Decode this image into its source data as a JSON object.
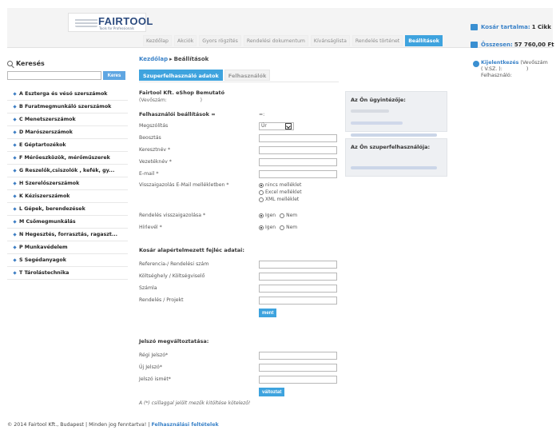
{
  "header": {
    "logo_text": "FAIRTOOL",
    "logo_sub": "Tools for Professionals",
    "nav": [
      "Kezdőlap",
      "Akciók",
      "Gyors rögzítés",
      "Rendelési dokumentum",
      "Kívánságlista",
      "Rendelés történet",
      "Beállítások"
    ],
    "cart_label": "Kosár tartalma:",
    "cart_value": "1 Cikk",
    "total_label": "Összesen:",
    "total_value": "57 760,00 Ft"
  },
  "search": {
    "title": "Keresés",
    "button": "Keres",
    "placeholder": ""
  },
  "sidebar": {
    "items": [
      "A Esztergа és vésó szerszámok",
      "B Furatmegmunkáló szerszámok",
      "C Menetszerszámok",
      "D Marószerszámok",
      "E Géptartozékok",
      "F Mérőeszközök, mérőműszerek",
      "G Reszelők,csiszolók , kefék, gy...",
      "H Szerelőszerszámok",
      "K Kéziszerszámok",
      "L Gépek, berendezések",
      "M Csőmegmunkálás",
      "N Hegesztés, forrasztás, ragaszt...",
      "P Munkavédelem",
      "S Segédanyagok",
      "T Tárolástechnika"
    ]
  },
  "main": {
    "breadcrumb_home": "Kezdőlap",
    "breadcrumb_sep": "▸",
    "breadcrumb_current": "Beállítások",
    "tabs": [
      "Szuperfelhasználó adatok",
      "Felhasználók"
    ],
    "company": "Fairtool Kft. eShop Bemutató",
    "vevoszam_label": "(Vevőszám:",
    "vevoszam_value": ")",
    "settings_title": "Felhasználói beállítások =",
    "settings_eq": "=:",
    "fields": {
      "megszolitas": "Megszólítás",
      "beosztas": "Beosztás",
      "keresztnev": "Keresztnév *",
      "vezeteknev": "Vezetéknév *",
      "email": "E-mail *",
      "visszaigazolas": "Visszaigazolás E-Mail mellékletben *",
      "rendeles_visszaigazolasa": "Rendelés visszaigazolása *",
      "hirlevel": "Hírlevél *"
    },
    "salutation_value": "Úr",
    "attachment_options": [
      "nincs melléklet",
      "Excel melléklet",
      "XML melléklet"
    ],
    "yes_no": [
      "Igen",
      "Nem"
    ],
    "cart_header_title": "Kosár alapértelmezett fejléc adatai:",
    "cart_fields": [
      "Referencia-/ Rendelési szám",
      "Költséghely / Költségviselő",
      "Számla",
      "Rendelés / Projekt"
    ],
    "save_button": "ment",
    "password_title": "Jelszó megváltoztatása:",
    "password_fields": [
      "Régi Jelszó*",
      "Új Jelszó*",
      "Jelszó ismét*"
    ],
    "change_button": "változtat",
    "note": "A (*) csillaggal jelölt mezők kitöltése kötelező!"
  },
  "right": {
    "agent_title": "Az Ön ügyintézője:",
    "superuser_title": "Az Ön szuperfelhasználója:"
  },
  "user": {
    "login_link": "Kijelentkezés",
    "vevoszam": "(Vevőszám",
    "vsz": "( V.SZ. ):",
    "close": ")",
    "felhasznalo": "Felhasználó:"
  },
  "footer": {
    "copyright": "© 2014 Fairtool Kft., Budapest | Minden jog fenntartva! |",
    "terms": "Felhasználási feltételek"
  }
}
